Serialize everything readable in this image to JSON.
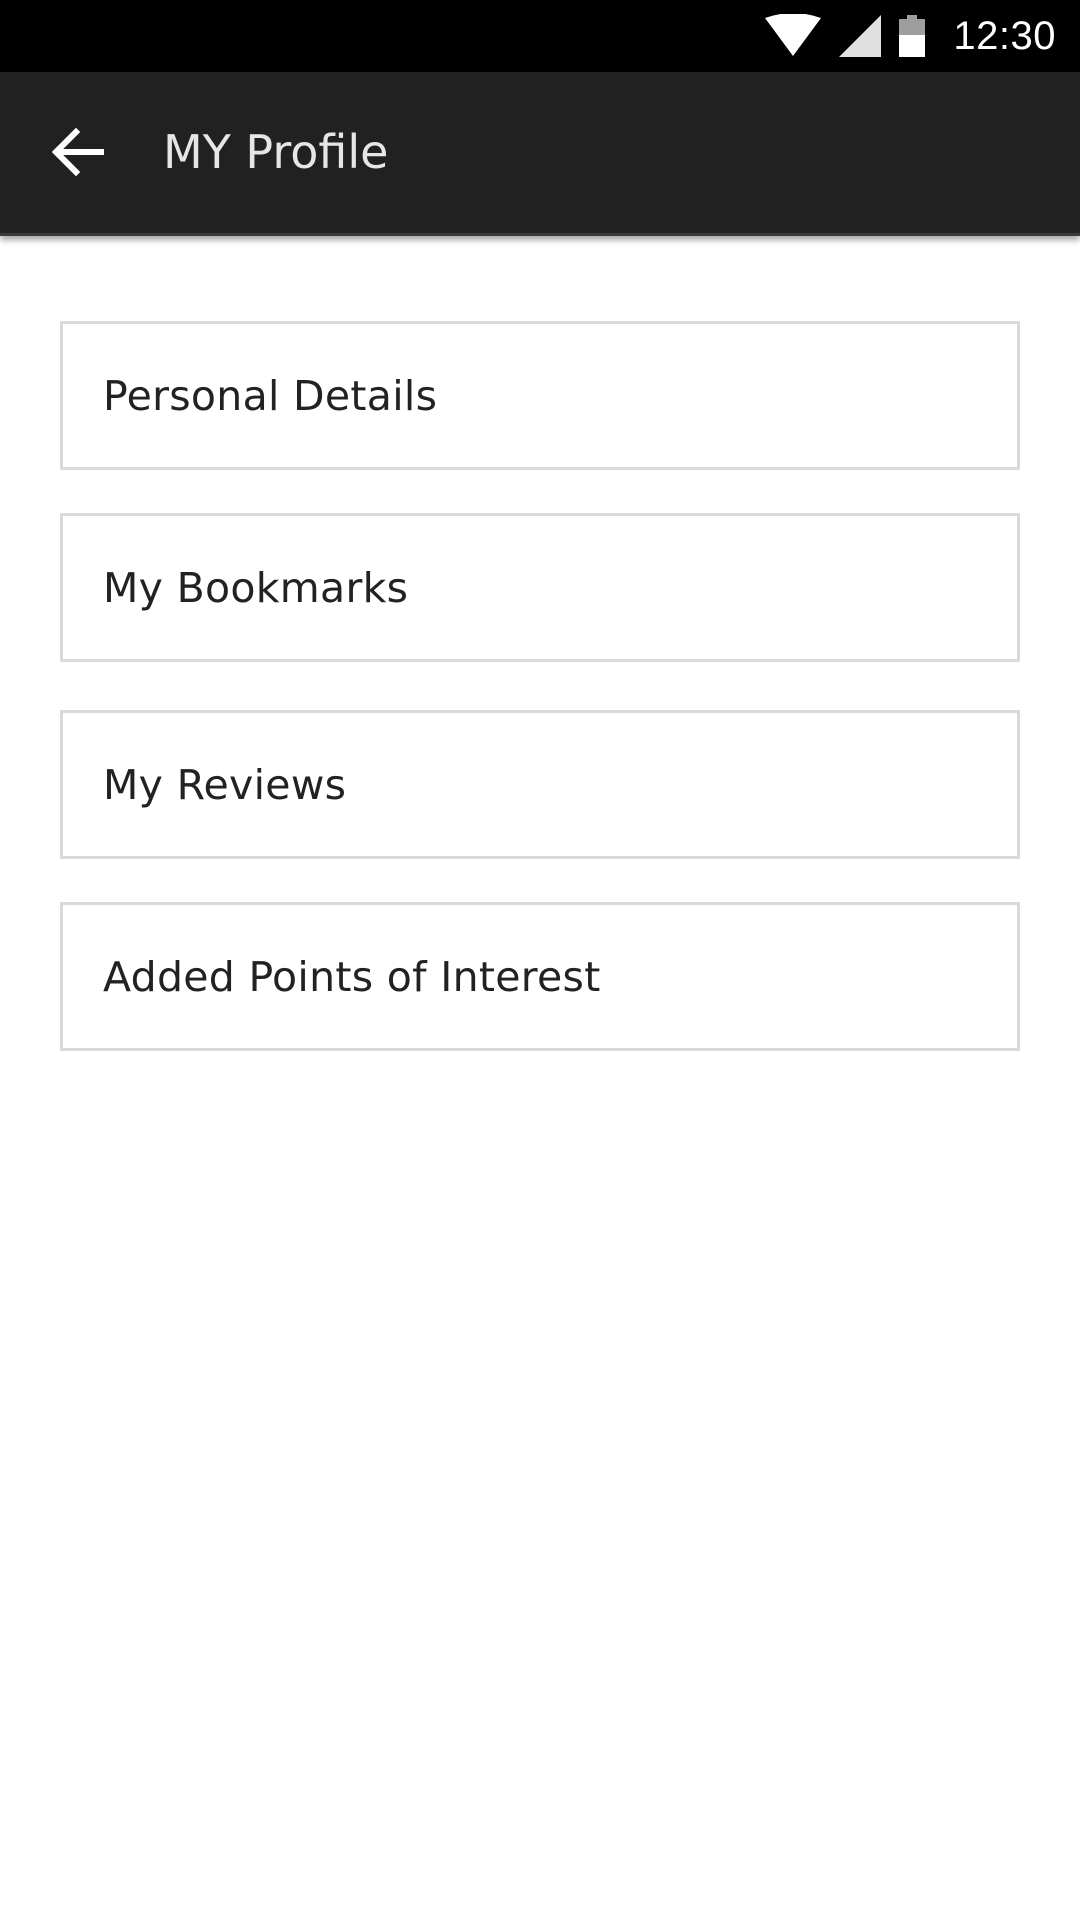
{
  "status_bar": {
    "time": "12:30",
    "icons": [
      "wifi-icon",
      "signal-icon",
      "battery-icon"
    ],
    "background": "#000000"
  },
  "app_bar": {
    "title": "MY Profile",
    "back_icon": "arrow-left-icon",
    "background": "#212121"
  },
  "menu": {
    "items": [
      {
        "label": "Personal Details"
      },
      {
        "label": "My Bookmarks"
      },
      {
        "label": "My Reviews"
      },
      {
        "label": "Added Points of Interest"
      }
    ],
    "border_color": "#d9d9d9"
  }
}
